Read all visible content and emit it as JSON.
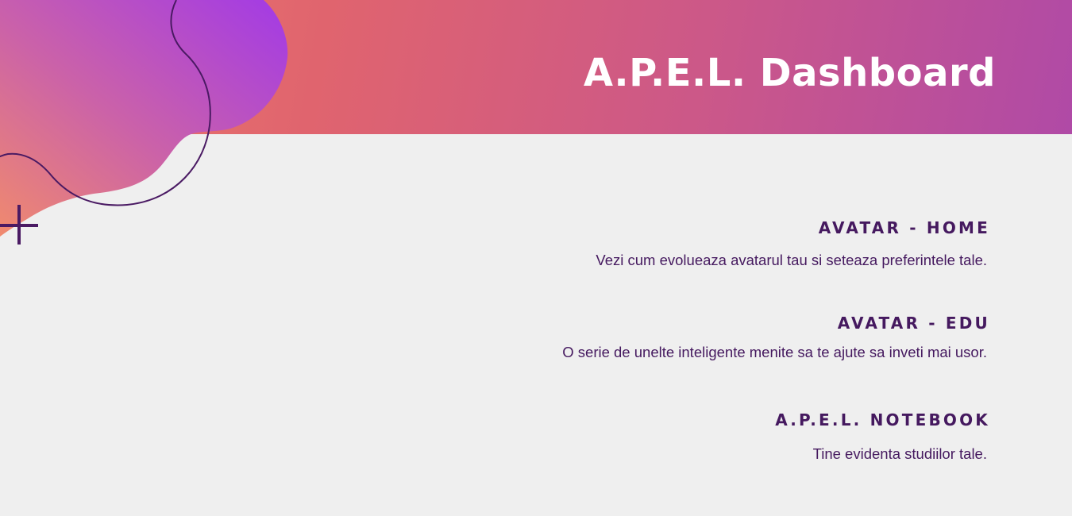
{
  "header": {
    "title": "A.P.E.L. Dashboard"
  },
  "menu": {
    "items": [
      {
        "title": "AVATAR - HOME",
        "description": "Vezi cum evolueaza avatarul tau si seteaza preferintele tale."
      },
      {
        "title": "AVATAR - EDU",
        "description": "O serie de unelte inteligente menite sa te ajute sa inveti mai usor."
      },
      {
        "title": "A.P.E.L. NOTEBOOK",
        "description": "Tine evidenta studiilor tale."
      }
    ]
  },
  "colors": {
    "background": "#efefef",
    "header_gradient_start": "#ec7e6a",
    "header_gradient_end": "#b04aa6",
    "blob_accent": "#a43ee0",
    "text_primary": "#45195f",
    "title_text": "#ffffff"
  },
  "decorations": {
    "icons": [
      "gradient-blob",
      "squiggle-line",
      "plus-icon"
    ]
  }
}
